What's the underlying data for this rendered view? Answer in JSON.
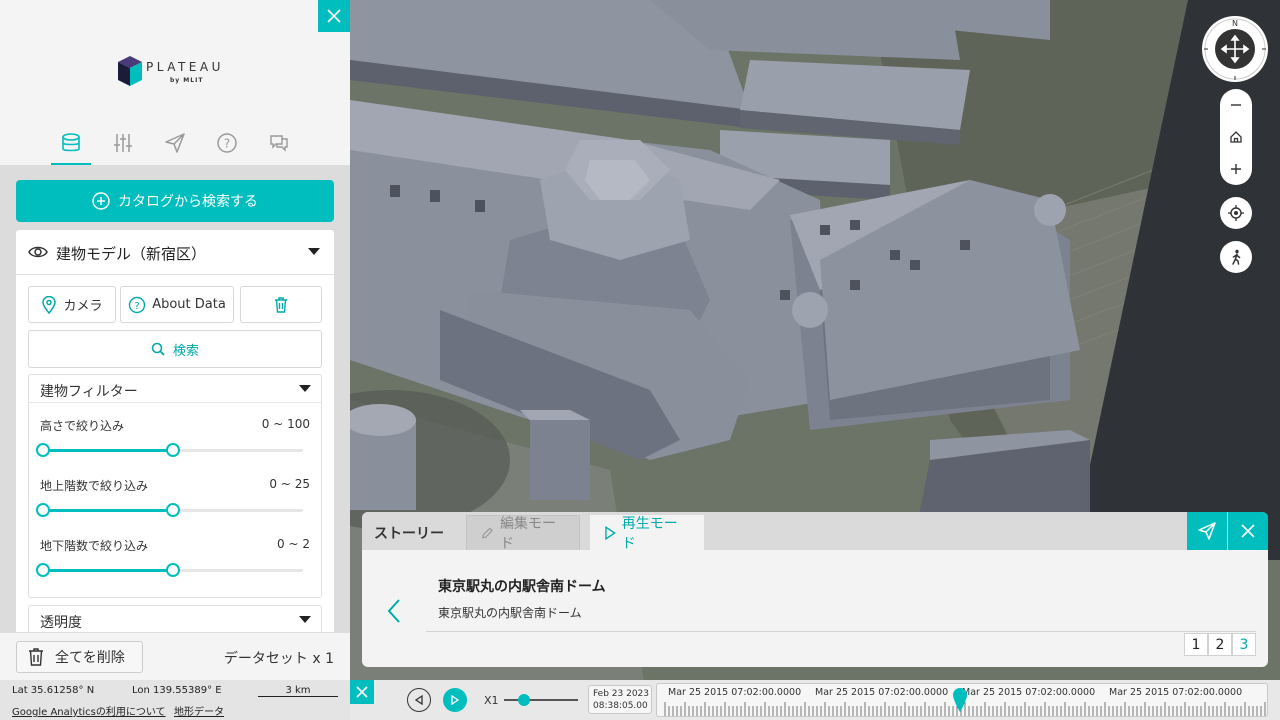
{
  "app": {
    "logo_text": "PLATEAU",
    "logo_sub": "by MLIT"
  },
  "panel": {
    "tabs": [
      {
        "icon": "database-icon",
        "active": true
      },
      {
        "icon": "sliders-icon",
        "active": false
      },
      {
        "icon": "paper-plane-icon",
        "active": false
      },
      {
        "icon": "help-icon",
        "active": false
      },
      {
        "icon": "chat-icon",
        "active": false
      }
    ],
    "catalog_button": "カタログから検索する",
    "dataset": {
      "title": "建物モデル（新宿区）",
      "camera_button": "カメラ",
      "about_button": "About Data",
      "search_button": "検索",
      "filter_title": "建物フィルター",
      "filters": [
        {
          "label": "高さで絞り込み",
          "range": "0 ~ 100",
          "min_fraction": 0,
          "max_fraction": 0.5
        },
        {
          "label": "地上階数で絞り込み",
          "range": "0 ~ 25",
          "min_fraction": 0,
          "max_fraction": 0.5
        },
        {
          "label": "地下階数で絞り込み",
          "range": "0 ~ 2",
          "min_fraction": 0,
          "max_fraction": 0.5
        }
      ],
      "transparency_title": "透明度"
    },
    "footer": {
      "delete_all": "全てを削除",
      "dataset_count": "データセット x 1"
    },
    "status": {
      "lat": "Lat  35.61258° N",
      "lon": "Lon  139.55389° E",
      "scale": "3 km",
      "analytics_link": "Google Analyticsの利用について",
      "terrain_link": "地形データ"
    }
  },
  "compass": {
    "north": "N"
  },
  "story": {
    "label": "ストーリー",
    "edit_tab": "編集モード",
    "play_tab": "再生モード",
    "title": "東京駅丸の内駅舎南ドーム",
    "description": "東京駅丸の内駅舎南ドーム",
    "pages": [
      "1",
      "2",
      "3"
    ],
    "active_page": "3"
  },
  "timeline": {
    "speed": "X1",
    "date": "Feb 23 2023",
    "time": "08:38:05.00",
    "labels": [
      "Mar 25 2015 07:02:00.0000",
      "Mar 25 2015 07:02:00.0000",
      "Mar 25 2015 07:02:00.0000",
      "Mar 25 2015 07:02:00.0000"
    ]
  },
  "colors": {
    "accent": "#00bebe",
    "building": "#8a8f9c",
    "building_dark": "#5c616d"
  }
}
